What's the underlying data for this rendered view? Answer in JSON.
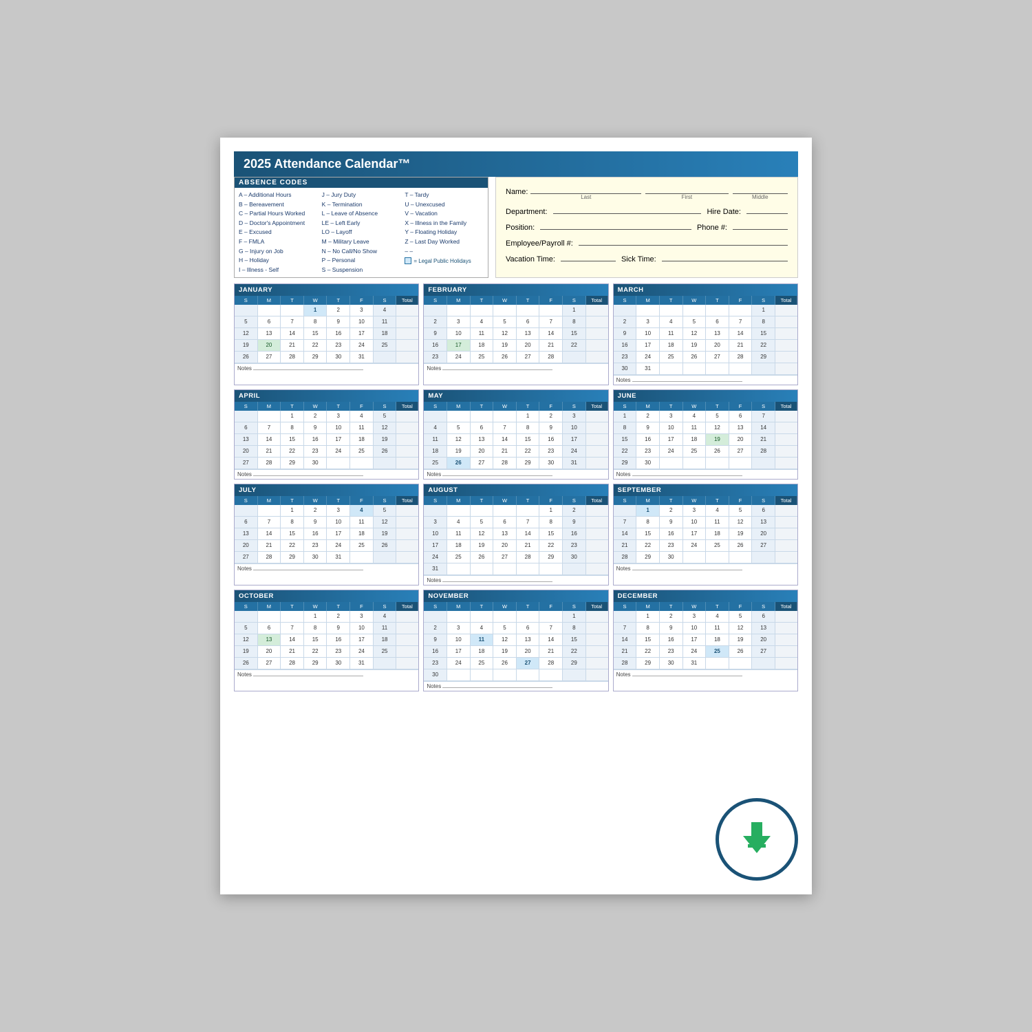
{
  "title": "2025 Attendance Calendar™",
  "absence_codes": {
    "header": "ABSENCE CODES",
    "col1": [
      "A – Additional Hours",
      "B – Bereavement",
      "C – Partial Hours Worked",
      "D – Doctor's Appointment",
      "E – Excused",
      "F – FMLA",
      "G – Injury on Job",
      "H – Holiday",
      "I  – Illness - Self"
    ],
    "col2": [
      "J  – Jury Duty",
      "K – Termination",
      "L  – Leave of Absence",
      "LE – Left Early",
      "LO – Layoff",
      "M – Military Leave",
      "N – No Call/No Show",
      "P  – Personal",
      "S  – Suspension"
    ],
    "col3": [
      "T – Tardy",
      "U – Unexcused",
      "V – Vacation",
      "X – Illness in the Family",
      "Y – Floating Holiday",
      "Z – Last Day Worked",
      "– –",
      "= Legal Public Holidays"
    ]
  },
  "form_fields": {
    "name_label": "Name:",
    "last_label": "Last",
    "first_label": "First",
    "middle_label": "Middle",
    "department_label": "Department:",
    "hire_date_label": "Hire Date:",
    "position_label": "Position:",
    "phone_label": "Phone #:",
    "employee_label": "Employee/Payroll #:",
    "vacation_label": "Vacation Time:",
    "sick_label": "Sick Time:"
  },
  "day_headers": [
    "S",
    "M",
    "T",
    "W",
    "T",
    "F",
    "S",
    "Total"
  ],
  "months": [
    {
      "name": "JANUARY",
      "weeks": [
        [
          "",
          "",
          "",
          "1",
          "2",
          "3",
          "4",
          ""
        ],
        [
          "5",
          "6",
          "7",
          "8",
          "9",
          "10",
          "11",
          ""
        ],
        [
          "12",
          "13",
          "14",
          "15",
          "16",
          "17",
          "18",
          ""
        ],
        [
          "19",
          "20",
          "21",
          "22",
          "23",
          "24",
          "25",
          ""
        ],
        [
          "26",
          "27",
          "28",
          "29",
          "30",
          "31",
          "",
          ""
        ]
      ],
      "holidays": [
        "1"
      ],
      "highlighted": [
        "20"
      ]
    },
    {
      "name": "FEBRUARY",
      "weeks": [
        [
          "",
          "",
          "",
          "",
          "",
          "",
          "1",
          ""
        ],
        [
          "2",
          "3",
          "4",
          "5",
          "6",
          "7",
          "8",
          ""
        ],
        [
          "9",
          "10",
          "11",
          "12",
          "13",
          "14",
          "15",
          ""
        ],
        [
          "16",
          "17",
          "18",
          "19",
          "20",
          "21",
          "22",
          ""
        ],
        [
          "23",
          "24",
          "25",
          "26",
          "27",
          "28",
          "",
          ""
        ]
      ],
      "holidays": [],
      "highlighted": [
        "17"
      ]
    },
    {
      "name": "MARCH",
      "weeks": [
        [
          "",
          "",
          "",
          "",
          "",
          "",
          "1",
          ""
        ],
        [
          "2",
          "3",
          "4",
          "5",
          "6",
          "7",
          "8",
          ""
        ],
        [
          "9",
          "10",
          "11",
          "12",
          "13",
          "14",
          "15",
          ""
        ],
        [
          "16",
          "17",
          "18",
          "19",
          "20",
          "21",
          "22",
          ""
        ],
        [
          "23",
          "24",
          "25",
          "26",
          "27",
          "28",
          "29",
          ""
        ],
        [
          "30",
          "31",
          "",
          "",
          "",
          "",
          "",
          ""
        ]
      ],
      "holidays": [],
      "highlighted": []
    },
    {
      "name": "APRIL",
      "weeks": [
        [
          "",
          "",
          "1",
          "2",
          "3",
          "4",
          "5",
          ""
        ],
        [
          "6",
          "7",
          "8",
          "9",
          "10",
          "11",
          "12",
          ""
        ],
        [
          "13",
          "14",
          "15",
          "16",
          "17",
          "18",
          "19",
          ""
        ],
        [
          "20",
          "21",
          "22",
          "23",
          "24",
          "25",
          "26",
          ""
        ],
        [
          "27",
          "28",
          "29",
          "30",
          "",
          "",
          "",
          ""
        ]
      ],
      "holidays": [],
      "highlighted": []
    },
    {
      "name": "MAY",
      "weeks": [
        [
          "",
          "",
          "",
          "",
          "1",
          "2",
          "3",
          ""
        ],
        [
          "4",
          "5",
          "6",
          "7",
          "8",
          "9",
          "10",
          ""
        ],
        [
          "11",
          "12",
          "13",
          "14",
          "15",
          "16",
          "17",
          ""
        ],
        [
          "18",
          "19",
          "20",
          "21",
          "22",
          "23",
          "24",
          ""
        ],
        [
          "25",
          "26",
          "27",
          "28",
          "29",
          "30",
          "31",
          ""
        ]
      ],
      "holidays": [
        "26"
      ],
      "highlighted": [
        "26"
      ]
    },
    {
      "name": "JUNE",
      "weeks": [
        [
          "1",
          "2",
          "3",
          "4",
          "5",
          "6",
          "7",
          ""
        ],
        [
          "8",
          "9",
          "10",
          "11",
          "12",
          "13",
          "14",
          ""
        ],
        [
          "15",
          "16",
          "17",
          "18",
          "19",
          "20",
          "21",
          ""
        ],
        [
          "22",
          "23",
          "24",
          "25",
          "26",
          "27",
          "28",
          ""
        ],
        [
          "29",
          "30",
          "",
          "",
          "",
          "",
          "",
          ""
        ]
      ],
      "holidays": [],
      "highlighted": [
        "19"
      ]
    },
    {
      "name": "JULY",
      "weeks": [
        [
          "",
          "",
          "1",
          "2",
          "3",
          "4",
          "5",
          ""
        ],
        [
          "6",
          "7",
          "8",
          "9",
          "10",
          "11",
          "12",
          ""
        ],
        [
          "13",
          "14",
          "15",
          "16",
          "17",
          "18",
          "19",
          ""
        ],
        [
          "20",
          "21",
          "22",
          "23",
          "24",
          "25",
          "26",
          ""
        ],
        [
          "27",
          "28",
          "29",
          "30",
          "31",
          "",
          "",
          ""
        ]
      ],
      "holidays": [
        "4"
      ],
      "highlighted": [
        "4"
      ]
    },
    {
      "name": "AUGUST",
      "weeks": [
        [
          "",
          "",
          "",
          "",
          "",
          "1",
          "2",
          ""
        ],
        [
          "3",
          "4",
          "5",
          "6",
          "7",
          "8",
          "9",
          ""
        ],
        [
          "10",
          "11",
          "12",
          "13",
          "14",
          "15",
          "16",
          ""
        ],
        [
          "17",
          "18",
          "19",
          "20",
          "21",
          "22",
          "23",
          ""
        ],
        [
          "24",
          "25",
          "26",
          "27",
          "28",
          "29",
          "30",
          ""
        ],
        [
          "31",
          "",
          "",
          "",
          "",
          "",
          "",
          ""
        ]
      ],
      "holidays": [],
      "highlighted": []
    },
    {
      "name": "SEPTEMBER",
      "weeks": [
        [
          "",
          "1",
          "2",
          "3",
          "4",
          "5",
          "6",
          ""
        ],
        [
          "7",
          "8",
          "9",
          "10",
          "11",
          "12",
          "13",
          ""
        ],
        [
          "14",
          "15",
          "16",
          "17",
          "18",
          "19",
          "20",
          ""
        ],
        [
          "21",
          "22",
          "23",
          "24",
          "25",
          "26",
          "27",
          ""
        ],
        [
          "28",
          "29",
          "30",
          "",
          "",
          "",
          "",
          ""
        ]
      ],
      "holidays": [
        "1"
      ],
      "highlighted": [
        "1"
      ]
    },
    {
      "name": "OCTOBER",
      "weeks": [
        [
          "",
          "",
          "",
          "1",
          "2",
          "3",
          "4",
          ""
        ],
        [
          "5",
          "6",
          "7",
          "8",
          "9",
          "10",
          "11",
          ""
        ],
        [
          "12",
          "13",
          "14",
          "15",
          "16",
          "17",
          "18",
          ""
        ],
        [
          "19",
          "20",
          "21",
          "22",
          "23",
          "24",
          "25",
          ""
        ],
        [
          "26",
          "27",
          "28",
          "29",
          "30",
          "31",
          "",
          ""
        ]
      ],
      "holidays": [],
      "highlighted": [
        "13"
      ]
    },
    {
      "name": "NOVEMBER",
      "weeks": [
        [
          "",
          "",
          "",
          "",
          "",
          "",
          "1",
          ""
        ],
        [
          "2",
          "3",
          "4",
          "5",
          "6",
          "7",
          "8",
          ""
        ],
        [
          "9",
          "10",
          "11",
          "12",
          "13",
          "14",
          "15",
          ""
        ],
        [
          "16",
          "17",
          "18",
          "19",
          "20",
          "21",
          "22",
          ""
        ],
        [
          "23",
          "24",
          "25",
          "26",
          "27",
          "28",
          "29",
          ""
        ],
        [
          "30",
          "",
          "",
          "",
          "",
          "",
          "",
          ""
        ]
      ],
      "holidays": [
        "11",
        "27"
      ],
      "highlighted": [
        "11",
        "27"
      ]
    },
    {
      "name": "DECEMBER",
      "weeks": [
        [
          "",
          "1",
          "2",
          "3",
          "4",
          "5",
          "6",
          ""
        ],
        [
          "7",
          "8",
          "9",
          "10",
          "11",
          "12",
          "13",
          ""
        ],
        [
          "14",
          "15",
          "16",
          "17",
          "18",
          "19",
          "20",
          ""
        ],
        [
          "21",
          "22",
          "23",
          "24",
          "25",
          "26",
          "27",
          ""
        ],
        [
          "28",
          "29",
          "30",
          "31",
          "",
          "",
          "",
          ""
        ]
      ],
      "holidays": [
        "25"
      ],
      "highlighted": []
    }
  ],
  "notes_label": "Notes",
  "holiday_legend": "= Legal Public Holidays",
  "download_icon": "⬇"
}
